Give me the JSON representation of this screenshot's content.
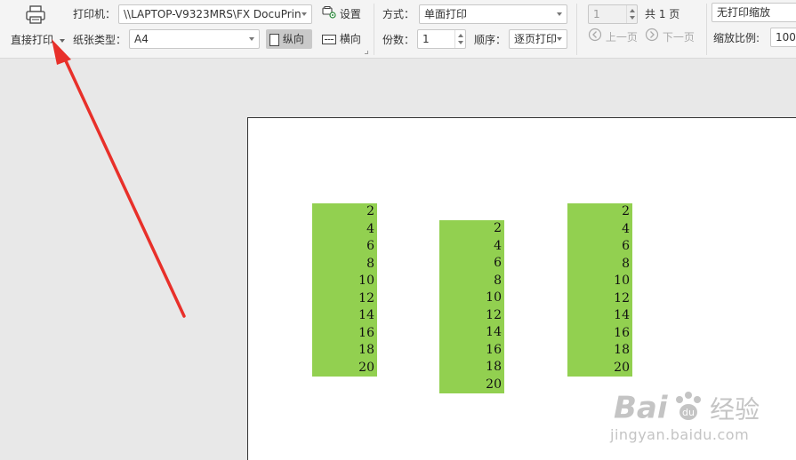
{
  "toolbar": {
    "direct_print_label": "直接打印",
    "printer_label": "打印机：",
    "printer_value": "\\\\LAPTOP-V9323MRS\\FX DocuPrin",
    "settings_label": "设置",
    "paper_type_label": "纸张类型：",
    "paper_type_value": "A4",
    "portrait_label": "纵向",
    "landscape_label": "横向",
    "mode_label": "方式：",
    "mode_value": "单面打印",
    "copies_label": "份数：",
    "copies_value": "1",
    "order_label": "顺序：",
    "order_value": "逐页打印",
    "page_current": "1",
    "page_total": "共 1 页",
    "prev_page": "上一页",
    "next_page": "下一页",
    "scale_value": "无打印缩放",
    "zoom_label": "缩放比例:",
    "zoom_value": "100"
  },
  "preview": {
    "columns": [
      [
        "2",
        "4",
        "6",
        "8",
        "10",
        "12",
        "14",
        "16",
        "18",
        "20"
      ],
      [
        "2",
        "4",
        "6",
        "8",
        "10",
        "12",
        "14",
        "16",
        "18",
        "20"
      ],
      [
        "2",
        "4",
        "6",
        "8",
        "10",
        "12",
        "14",
        "16",
        "18",
        "20"
      ]
    ]
  },
  "watermark": {
    "brand_left": "Bai",
    "brand_right": "经验",
    "url": "jingyan.baidu.com"
  },
  "colors": {
    "cell_fill": "#92d050",
    "annotation_arrow": "#e8302a"
  }
}
